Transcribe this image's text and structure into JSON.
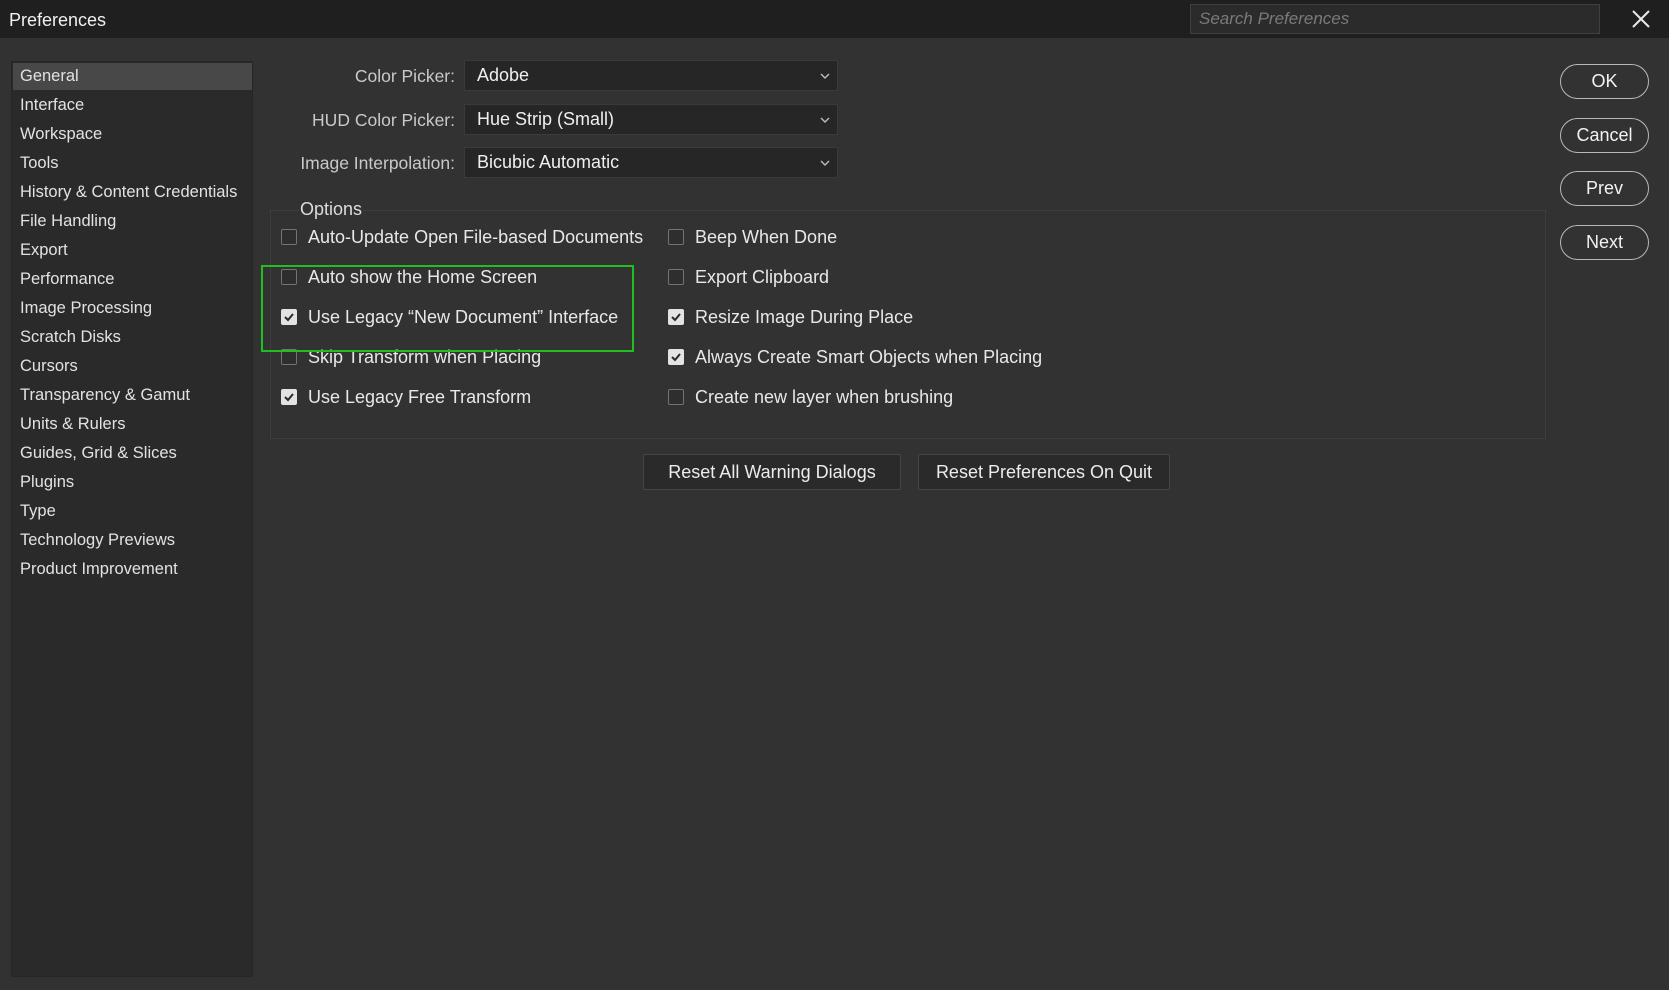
{
  "window": {
    "title": "Preferences",
    "search_placeholder": "Search Preferences"
  },
  "icons": {
    "close": "close-icon",
    "dropdown": "chevron-down-icon",
    "check": "checkmark-icon"
  },
  "colors": {
    "background": "#323232",
    "titlebar": "#1f1f1f",
    "sidebar": "#2a2a2a",
    "sidebar_active": "#484848",
    "highlight": "#1fbf1f"
  },
  "sidebar": {
    "active": "General",
    "items": [
      {
        "label": "General"
      },
      {
        "label": "Interface"
      },
      {
        "label": "Workspace"
      },
      {
        "label": "Tools"
      },
      {
        "label": "History & Content Credentials"
      },
      {
        "label": "File Handling"
      },
      {
        "label": "Export"
      },
      {
        "label": "Performance"
      },
      {
        "label": "Image Processing"
      },
      {
        "label": "Scratch Disks"
      },
      {
        "label": "Cursors"
      },
      {
        "label": "Transparency & Gamut"
      },
      {
        "label": "Units & Rulers"
      },
      {
        "label": "Guides, Grid & Slices"
      },
      {
        "label": "Plugins"
      },
      {
        "label": "Type"
      },
      {
        "label": "Technology Previews"
      },
      {
        "label": "Product Improvement"
      }
    ]
  },
  "fields": {
    "color_picker": {
      "label": "Color Picker:",
      "value": "Adobe"
    },
    "hud_color_picker": {
      "label": "HUD Color Picker:",
      "value": "Hue Strip (Small)"
    },
    "image_interpolation": {
      "label": "Image Interpolation:",
      "value": "Bicubic Automatic"
    }
  },
  "options": {
    "title": "Options",
    "left": [
      {
        "label": "Auto-Update Open File-based Documents",
        "checked": false
      },
      {
        "label": "Auto show the Home Screen",
        "checked": false
      },
      {
        "label": "Use Legacy “New Document” Interface",
        "checked": true
      },
      {
        "label": "Skip Transform when Placing",
        "checked": false
      },
      {
        "label": "Use Legacy Free Transform",
        "checked": true
      }
    ],
    "right": [
      {
        "label": "Beep When Done",
        "checked": false
      },
      {
        "label": "Export Clipboard",
        "checked": false
      },
      {
        "label": "Resize Image During Place",
        "checked": true
      },
      {
        "label": "Always Create Smart Objects when Placing",
        "checked": true
      },
      {
        "label": "Create new layer when brushing",
        "checked": false
      }
    ]
  },
  "buttons": {
    "reset_warnings": "Reset All Warning Dialogs",
    "reset_prefs": "Reset Preferences On Quit",
    "ok": "OK",
    "cancel": "Cancel",
    "prev": "Prev",
    "next": "Next"
  }
}
